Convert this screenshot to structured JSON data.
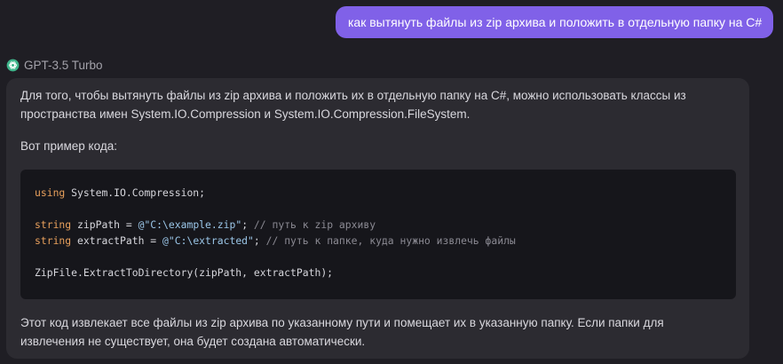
{
  "user_message": {
    "text": "как вытянуть файлы из zip архива и положить в отдельную папку на C#"
  },
  "assistant": {
    "model_name": "GPT-3.5 Turbo",
    "model_icon": "openai-logo-icon",
    "intro": "Для того, чтобы вытянуть файлы из zip архива и положить их в отдельную папку на C#, можно использовать классы из пространства имен System.IO.Compression и System.IO.Compression.FileSystem.",
    "example_label": "Вот пример кода:",
    "code": {
      "line1": {
        "kw": "using",
        "rest": " System.IO.Compression;"
      },
      "line3": {
        "kw": "string",
        "var": " zipPath = ",
        "str": "@\"C:\\example.zip\"",
        "semi": ";",
        "comment": " // путь к zip архиву"
      },
      "line4": {
        "kw": "string",
        "var": " extractPath = ",
        "str": "@\"C:\\extracted\"",
        "semi": ";",
        "comment": " // путь к папке, куда нужно извлечь файлы"
      },
      "line6": {
        "rest": "ZipFile.ExtractToDirectory(zipPath, extractPath);"
      }
    },
    "outro": "Этот код извлекает все файлы из zip архива по указанному пути и помещает их в указанную папку. Если папки для извлечения не существует, она будет создана автоматически."
  },
  "colors": {
    "background": "#1f1e24",
    "user_bubble": "#8061e8",
    "assistant_card": "#2c2b31",
    "code_background": "#16161b",
    "keyword": "#e8a05c",
    "string": "#9bc6e8",
    "comment": "#8b8a93",
    "model_icon": "#3fb58b"
  }
}
